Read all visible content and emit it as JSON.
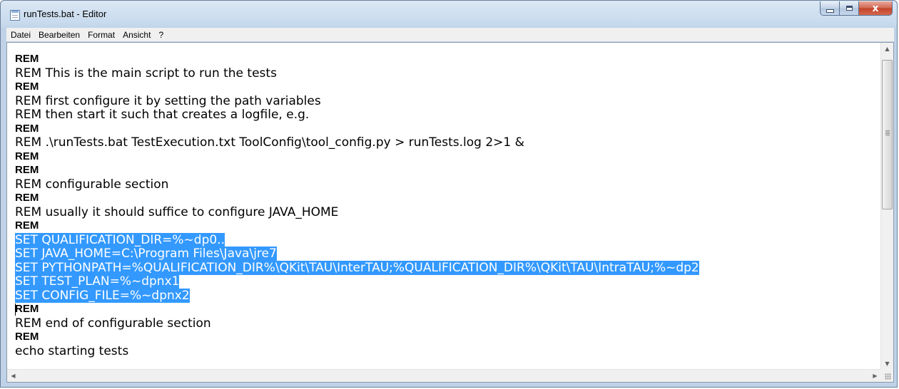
{
  "window": {
    "title": "runTests.bat - Editor"
  },
  "caption_buttons": {
    "close_glyph": "x"
  },
  "menu": [
    "Datei",
    "Bearbeiten",
    "Format",
    "Ansicht",
    "?"
  ],
  "lines": [
    {
      "text": "REM",
      "bold": true
    },
    {
      "text": "REM This is the main script to run the tests"
    },
    {
      "text": "REM",
      "bold": true
    },
    {
      "text": "REM first configure it by setting the path variables"
    },
    {
      "text": "REM then start it such that creates a logfile, e.g."
    },
    {
      "text": "REM",
      "bold": true
    },
    {
      "text": "REM .\\runTests.bat TestExecution.txt ToolConfig\\tool_config.py > runTests.log 2>1 &"
    },
    {
      "text": "REM",
      "bold": true
    },
    {
      "text": "REM",
      "bold": true
    },
    {
      "text": "REM configurable section"
    },
    {
      "text": "REM",
      "bold": true
    },
    {
      "text": "REM usually it should suffice to configure JAVA_HOME"
    },
    {
      "text": "REM",
      "bold": true
    },
    {
      "text": "SET QUALIFICATION_DIR=%~dp0..",
      "selected": true
    },
    {
      "text": "SET JAVA_HOME=C:\\Program Files\\Java\\jre7",
      "selected": true
    },
    {
      "text": "SET PYTHONPATH=%QUALIFICATION_DIR%\\QKit\\TAU\\InterTAU;%QUALIFICATION_DIR%\\QKit\\TAU\\IntraTAU;%~dp2",
      "selected": true
    },
    {
      "text": "SET TEST_PLAN=%~dpnx1",
      "selected": true
    },
    {
      "text": "SET CONFIG_FILE=%~dpnx2",
      "selected": true
    },
    {
      "text": "REM",
      "bold": true
    },
    {
      "text": "REM end of configurable section"
    },
    {
      "text": "REM",
      "bold": true
    },
    {
      "text": "echo starting tests"
    }
  ],
  "colors": {
    "selection": "#3399ff",
    "selection_text": "#ffffff",
    "close_button": "#c2432a"
  },
  "scrollbar": {
    "vertical_thumb_icon": "grip-icon",
    "up_arrow": "▲",
    "down_arrow": "▼",
    "left_arrow": "◀",
    "right_arrow": "▶"
  }
}
